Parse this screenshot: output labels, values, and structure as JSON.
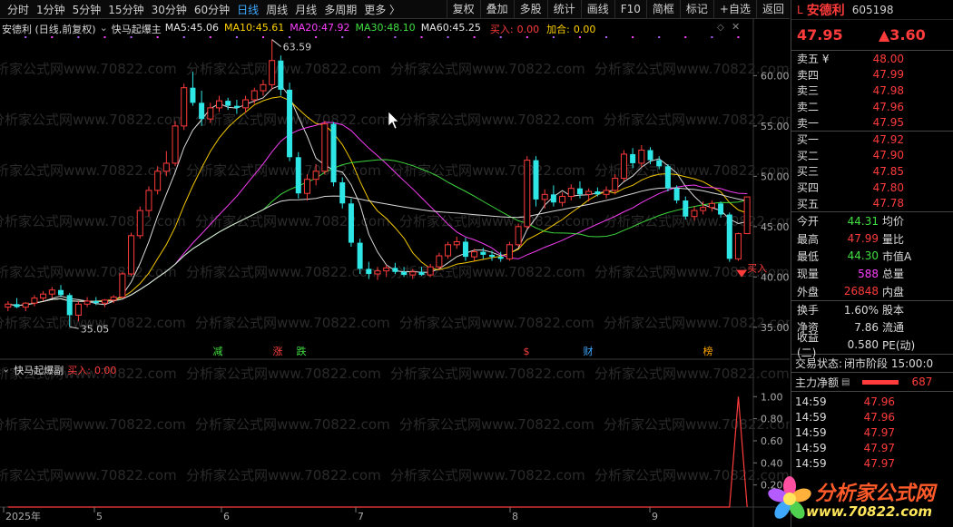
{
  "toolbar": {
    "periods": [
      "分时",
      "1分钟",
      "5分钟",
      "15分钟",
      "30分钟",
      "60分钟",
      "日线",
      "周线",
      "月线",
      "多周期",
      "更多 〉"
    ],
    "active_period": "日线",
    "tools": [
      "复权",
      "叠加",
      "多股",
      "统计",
      "画线",
      "F10",
      "简框",
      "标记",
      "+自选",
      "返回"
    ]
  },
  "main_chart": {
    "title": "安德利 (日线,前复权)",
    "indicator": "快马起爆主",
    "ma": [
      {
        "label": "MA5:",
        "value": "45.06",
        "color": "#e6e6e6"
      },
      {
        "label": "MA10:",
        "value": "45.61",
        "color": "#ffd200"
      },
      {
        "label": "MA20:",
        "value": "47.92",
        "color": "#ff40ff"
      },
      {
        "label": "MA30:",
        "value": "48.10",
        "color": "#40e040"
      },
      {
        "label": "MA60:",
        "value": "45.25",
        "color": "#e6e6e6"
      }
    ],
    "signal_label": "买入:",
    "signal_value": "0.00",
    "hecang_label": "加合:",
    "hecang_value": "0.00",
    "high_mark": "63.59",
    "low_mark": "35.05",
    "buy_label": "买入",
    "price_axis": [
      "60.00",
      "55.00",
      "50.00",
      "45.00",
      "40.00",
      "35.00"
    ],
    "event_tags": [
      {
        "text": "减",
        "color": "#40e040"
      },
      {
        "text": "涨",
        "color": "#ff4040"
      },
      {
        "text": "跌",
        "color": "#40e040"
      },
      {
        "text": "$",
        "color": "#ff4040"
      },
      {
        "text": "财",
        "color": "#3ea8ff"
      },
      {
        "text": "榜",
        "color": "#ffa500"
      }
    ]
  },
  "sub_chart": {
    "title": "快马起爆副",
    "signal_label": "买入:",
    "signal_value": "0.00",
    "axis": [
      "1.00",
      "0.80",
      "0.60",
      "0.40",
      "0.20"
    ]
  },
  "time_axis": [
    "2025年",
    "5",
    "6",
    "7",
    "8",
    "9"
  ],
  "watermark": "分析家公式网www.70822.com",
  "chart_data": {
    "type": "candlestick",
    "y_range": [
      33,
      64
    ],
    "candles": [
      [
        37.0,
        37.6,
        36.6,
        37.3
      ],
      [
        37.3,
        37.9,
        36.9,
        37.0
      ],
      [
        37.0,
        37.5,
        36.6,
        37.4
      ],
      [
        37.4,
        38.2,
        37.1,
        37.9
      ],
      [
        37.9,
        38.6,
        37.6,
        38.3
      ],
      [
        38.3,
        39.0,
        37.9,
        38.7
      ],
      [
        38.7,
        39.2,
        38.0,
        38.2
      ],
      [
        38.2,
        38.4,
        35.05,
        36.2
      ],
      [
        36.2,
        37.6,
        35.6,
        37.3
      ],
      [
        37.3,
        38.0,
        37.0,
        37.6
      ],
      [
        37.6,
        38.0,
        37.2,
        37.4
      ],
      [
        37.4,
        37.8,
        37.0,
        37.7
      ],
      [
        37.7,
        38.2,
        37.4,
        38.0
      ],
      [
        38.0,
        40.5,
        37.9,
        40.3
      ],
      [
        40.3,
        44.4,
        40.1,
        44.1
      ],
      [
        44.1,
        47.0,
        43.8,
        46.6
      ],
      [
        46.6,
        49.0,
        46.0,
        48.6
      ],
      [
        48.6,
        51.0,
        48.2,
        50.5
      ],
      [
        50.5,
        52.5,
        50.0,
        51.3
      ],
      [
        51.3,
        55.5,
        51.0,
        55.0
      ],
      [
        55.0,
        59.2,
        54.6,
        58.8
      ],
      [
        58.8,
        60.4,
        57.0,
        57.3
      ],
      [
        57.3,
        58.5,
        55.0,
        55.7
      ],
      [
        55.7,
        57.3,
        55.3,
        56.8
      ],
      [
        56.8,
        58.0,
        56.4,
        57.5
      ],
      [
        57.5,
        57.8,
        56.6,
        57.0
      ],
      [
        57.0,
        57.6,
        56.2,
        56.8
      ],
      [
        56.8,
        58.0,
        56.3,
        57.6
      ],
      [
        57.6,
        58.8,
        57.2,
        58.5
      ],
      [
        58.5,
        59.6,
        58.0,
        59.1
      ],
      [
        59.1,
        63.59,
        58.6,
        61.5
      ],
      [
        61.5,
        62.0,
        58.0,
        58.6
      ],
      [
        58.6,
        59.3,
        51.5,
        51.9
      ],
      [
        51.9,
        52.4,
        47.8,
        48.3
      ],
      [
        48.3,
        50.2,
        47.6,
        49.7
      ],
      [
        49.7,
        51.2,
        49.1,
        50.5
      ],
      [
        50.5,
        55.5,
        50.2,
        55.2
      ],
      [
        55.2,
        55.4,
        49.0,
        49.4
      ],
      [
        49.4,
        49.9,
        46.8,
        47.3
      ],
      [
        47.3,
        47.8,
        43.0,
        43.4
      ],
      [
        43.4,
        43.8,
        40.3,
        40.8
      ],
      [
        40.8,
        41.5,
        39.8,
        40.3
      ],
      [
        40.3,
        41.0,
        39.7,
        40.6
      ],
      [
        40.6,
        41.2,
        40.0,
        40.9
      ],
      [
        40.9,
        41.4,
        40.3,
        40.5
      ],
      [
        40.5,
        41.0,
        40.0,
        40.2
      ],
      [
        40.2,
        40.8,
        39.8,
        40.5
      ],
      [
        40.5,
        41.0,
        40.1,
        40.2
      ],
      [
        40.2,
        41.3,
        40.0,
        41.0
      ],
      [
        41.0,
        42.4,
        40.7,
        42.1
      ],
      [
        42.1,
        43.5,
        41.8,
        43.2
      ],
      [
        43.2,
        44.0,
        42.8,
        43.5
      ],
      [
        43.5,
        43.9,
        41.6,
        42.0
      ],
      [
        42.0,
        42.8,
        41.6,
        42.5
      ],
      [
        42.5,
        42.9,
        41.8,
        42.2
      ],
      [
        42.2,
        42.6,
        41.6,
        42.0
      ],
      [
        42.0,
        42.5,
        41.5,
        41.8
      ],
      [
        41.8,
        43.5,
        41.6,
        43.2
      ],
      [
        43.2,
        45.3,
        43.0,
        45.0
      ],
      [
        45.0,
        52.0,
        44.8,
        51.6
      ],
      [
        51.6,
        52.0,
        47.0,
        47.7
      ],
      [
        47.7,
        48.7,
        46.8,
        48.2
      ],
      [
        48.2,
        49.1,
        47.0,
        47.4
      ],
      [
        47.4,
        48.4,
        47.0,
        48.0
      ],
      [
        48.0,
        49.2,
        47.6,
        48.8
      ],
      [
        48.8,
        49.5,
        47.8,
        48.2
      ],
      [
        48.2,
        48.8,
        47.5,
        48.5
      ],
      [
        48.5,
        48.9,
        48.0,
        48.2
      ],
      [
        48.2,
        49.0,
        47.8,
        48.6
      ],
      [
        48.6,
        50.2,
        48.2,
        49.8
      ],
      [
        49.8,
        52.6,
        49.5,
        52.2
      ],
      [
        52.2,
        52.8,
        50.8,
        51.3
      ],
      [
        51.3,
        53.1,
        50.9,
        52.6
      ],
      [
        52.6,
        52.9,
        51.2,
        51.6
      ],
      [
        51.6,
        52.0,
        50.7,
        51.0
      ],
      [
        51.0,
        51.2,
        48.5,
        48.8
      ],
      [
        48.8,
        49.1,
        47.3,
        47.6
      ],
      [
        47.6,
        48.0,
        45.7,
        46.0
      ],
      [
        46.0,
        47.0,
        45.6,
        46.6
      ],
      [
        46.6,
        47.5,
        46.2,
        46.9
      ],
      [
        46.9,
        47.6,
        46.5,
        47.3
      ],
      [
        47.3,
        47.5,
        45.9,
        46.2
      ],
      [
        46.2,
        46.4,
        41.5,
        41.8
      ],
      [
        41.8,
        44.4,
        41.6,
        44.3
      ],
      [
        44.3,
        47.99,
        44.3,
        47.95
      ]
    ],
    "volume_signal": {
      "index": 83,
      "value": 1.0
    },
    "sub_y_range": [
      0,
      1.15
    ]
  },
  "quote": {
    "market_mark": "L",
    "name": "安德利",
    "code": "605198",
    "price": "47.95",
    "change": "▲3.60",
    "asks": [
      {
        "label": "卖五 ¥",
        "price": "48.00"
      },
      {
        "label": "卖四",
        "price": "47.99"
      },
      {
        "label": "卖三",
        "price": "47.98"
      },
      {
        "label": "卖二",
        "price": "47.96"
      },
      {
        "label": "卖一",
        "price": "47.95"
      }
    ],
    "bids": [
      {
        "label": "买一",
        "price": "47.92"
      },
      {
        "label": "买二",
        "price": "47.90"
      },
      {
        "label": "买三",
        "price": "47.85"
      },
      {
        "label": "买四",
        "price": "47.80"
      },
      {
        "label": "买五",
        "price": "47.78"
      }
    ],
    "stats1": [
      {
        "l1": "今开",
        "v": "44.31",
        "c": "#40e040",
        "l2": "均价"
      },
      {
        "l1": "最高",
        "v": "47.99",
        "c": "#ff3b3b",
        "l2": "量比"
      },
      {
        "l1": "最低",
        "v": "44.30",
        "c": "#40e040",
        "l2": "市值A"
      },
      {
        "l1": "现量",
        "v": "588",
        "c": "#ff40ff",
        "l2": "总量"
      },
      {
        "l1": "外盘",
        "v": "26848",
        "c": "#ff3b3b",
        "l2": "内盘"
      }
    ],
    "stats2": [
      {
        "l1": "换手",
        "v": "1.60%",
        "c": "#dcdcdc",
        "l2": "股本"
      },
      {
        "l1": "净资",
        "v": "7.86",
        "c": "#dcdcdc",
        "l2": "流通"
      },
      {
        "l1": "收益(二)",
        "v": "0.580",
        "c": "#dcdcdc",
        "l2": "PE(动)"
      }
    ],
    "trade_status_label": "交易状态:",
    "trade_status": "闭市阶段 15:00:0",
    "main_net_label": "主力净额",
    "main_net_value": "687",
    "ticks": [
      {
        "t": "14:59",
        "v": "47.96"
      },
      {
        "t": "14:59",
        "v": "47.96"
      },
      {
        "t": "14:59",
        "v": "47.97"
      },
      {
        "t": "14:59",
        "v": "47.97"
      },
      {
        "t": "14:59",
        "v": "47.97"
      }
    ]
  },
  "logo": {
    "title": "分析家公式网",
    "url": "www.70822.com"
  }
}
